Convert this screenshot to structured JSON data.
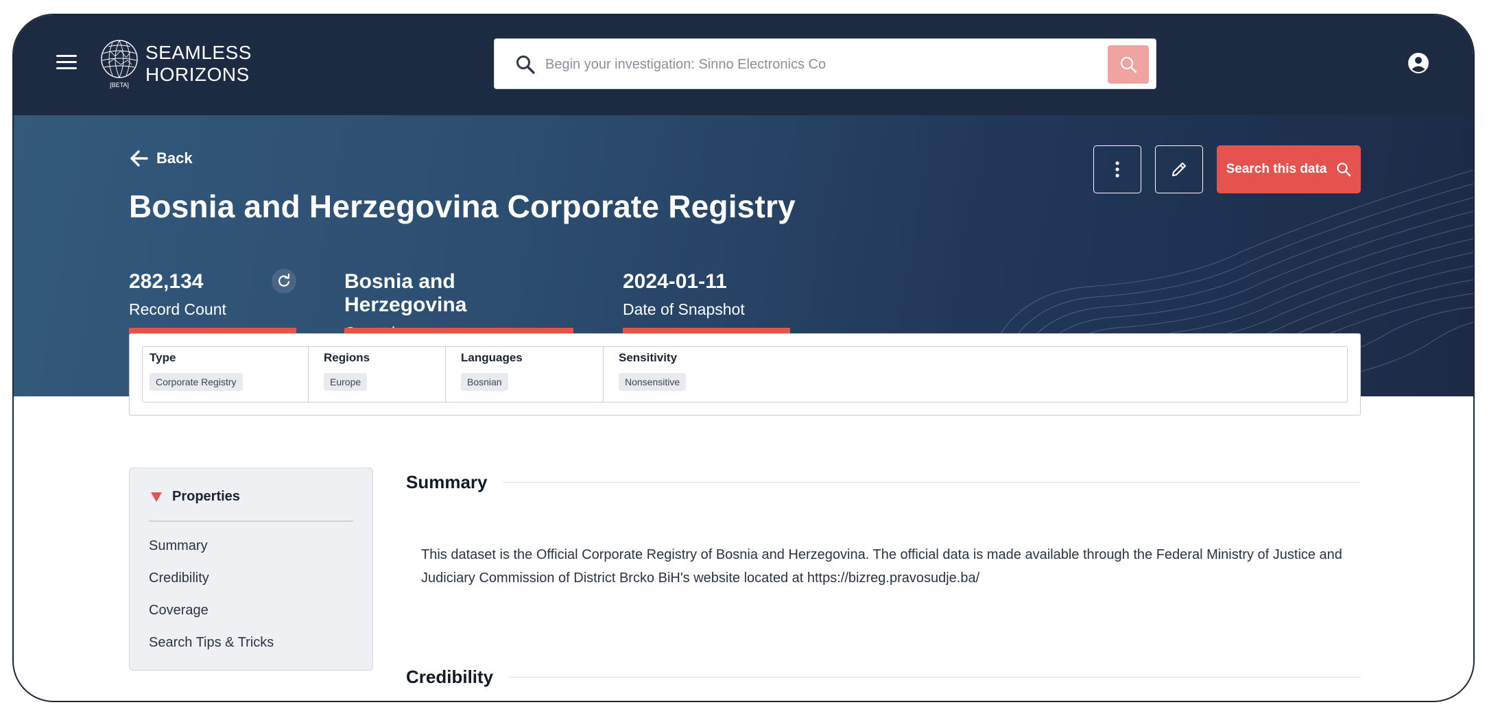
{
  "brand": {
    "name_line1": "SEAMLESS",
    "name_line2": "HORIZONS",
    "badge": "[BETA]"
  },
  "search": {
    "placeholder": "Begin your investigation: Sinno Electronics Co"
  },
  "hero": {
    "back_label": "Back",
    "title": "Bosnia and Herzegovina Corporate Registry",
    "search_data_label": "Search this data"
  },
  "stats": {
    "record_count": "282,134",
    "record_count_label": "Record Count",
    "countries": "Bosnia and Herzegovina",
    "countries_label": "Countries",
    "snapshot_date": "2024-01-11",
    "snapshot_label": "Date of Snapshot"
  },
  "meta": {
    "type": {
      "header": "Type",
      "value": "Corporate Registry"
    },
    "regions": {
      "header": "Regions",
      "value": "Europe"
    },
    "languages": {
      "header": "Languages",
      "value": "Bosnian"
    },
    "sensitivity": {
      "header": "Sensitivity",
      "value": "Nonsensitive"
    }
  },
  "sidebar": {
    "header": "Properties",
    "items": [
      {
        "label": "Summary"
      },
      {
        "label": "Credibility"
      },
      {
        "label": "Coverage"
      },
      {
        "label": "Search Tips & Tricks"
      }
    ]
  },
  "content": {
    "summary_heading": "Summary",
    "summary_text": "This dataset is the Official Corporate Registry of Bosnia and Herzegovina. The official data is made available through the Federal Ministry of Justice and Judiciary Commission of District Brcko BiH's website located at https://bizreg.pravosudje.ba/",
    "credibility_heading": "Credibility"
  },
  "colors": {
    "nav_bg": "#1c2a42",
    "accent": "#e5534f",
    "search_button": "#f0a3a0"
  },
  "icons": {
    "menu": "hamburger-menu-icon",
    "search": "search-icon",
    "account": "account-circle-icon",
    "back": "arrow-left-icon",
    "more": "more-vertical-icon",
    "edit": "pencil-icon",
    "refresh": "refresh-icon",
    "collapse": "triangle-down-icon"
  }
}
